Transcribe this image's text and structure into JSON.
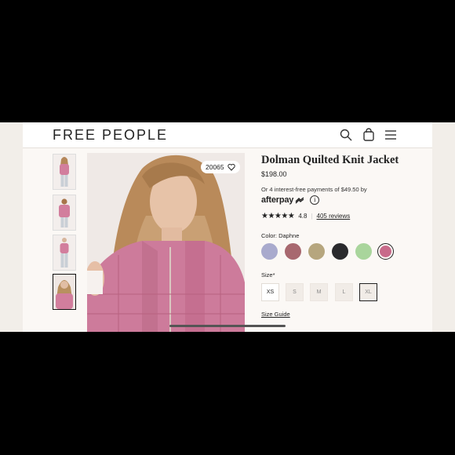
{
  "brand": "FREE PEOPLE",
  "header_icons": [
    "search-icon",
    "bag-icon",
    "menu-icon"
  ],
  "product": {
    "title": "Dolman Quilted Knit Jacket",
    "price": "$198.00",
    "installments": "Or 4 interest-free payments of $49.50 by",
    "afterpay": "afterpay",
    "info": "i",
    "stars": "★★★★★",
    "rating": "4.8",
    "reviews": "405 reviews",
    "favorites": "20065",
    "color_label": "Color: Daphne",
    "colors": [
      "#a9aacd",
      "#a8686f",
      "#b6a67e",
      "#2a2a2d",
      "#a9d59c",
      "#c86a8a"
    ],
    "selected_color_index": 5,
    "size_label": "Size*",
    "sizes": [
      {
        "label": "XS",
        "available": true
      },
      {
        "label": "S",
        "available": false
      },
      {
        "label": "M",
        "available": false
      },
      {
        "label": "L",
        "available": false
      },
      {
        "label": "XL",
        "available": false,
        "selected": true
      }
    ],
    "size_guide": "Size Guide"
  },
  "thumbnails": 4,
  "active_thumbnail_index": 3
}
